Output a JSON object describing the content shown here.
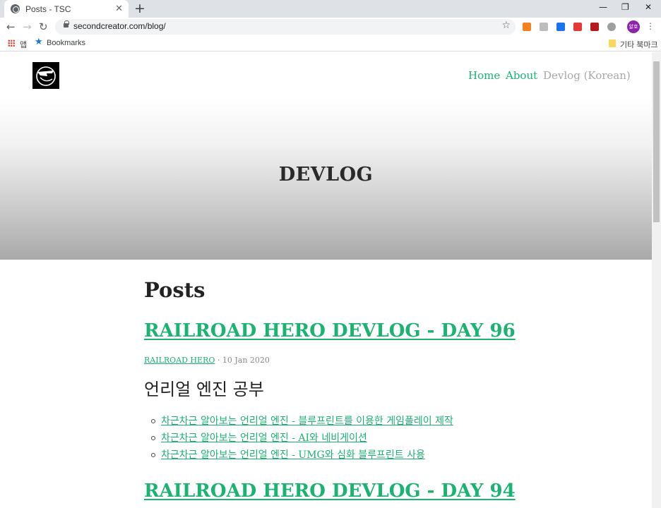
{
  "browser": {
    "tab_title": "Posts - TSC",
    "tab_close": "✕",
    "new_tab": "+",
    "url": "secondcreator.com/blog/",
    "profile_initials": "알호",
    "bookmarks_bar": {
      "apps_label": "앱",
      "bookmarks_label": "Bookmarks",
      "other_bookmarks_label": "기타 북마크"
    },
    "extension_colors": [
      "#f4821f",
      "#9e9e9e",
      "#1a73e8",
      "#e53935",
      "#b71c1c",
      "#9e9e9e"
    ]
  },
  "site": {
    "nav": {
      "home": "Home",
      "about": "About",
      "devlog_korean": "Devlog (Korean)"
    },
    "hero_title": "DEVLOG",
    "accent_color": "#1ab371"
  },
  "main": {
    "heading": "Posts",
    "posts": [
      {
        "title": "RAILROAD HERO DEVLOG - DAY 96",
        "tag": "RAILROAD HERO",
        "date": "· 10 Jan 2020",
        "subheading": "언리얼 엔진 공부",
        "links": [
          "차근차근 알아보는 언리얼 엔진 - 블루프린트를 이용한 게임플레이 제작",
          "차근차근 알아보는 언리얼 엔진 - AI와 네비게이션",
          "차근차근 알아보는 언리얼 엔진 - UMG와 심화 블루프린트 사용"
        ]
      },
      {
        "title": "RAILROAD HERO DEVLOG - DAY 94"
      }
    ]
  }
}
